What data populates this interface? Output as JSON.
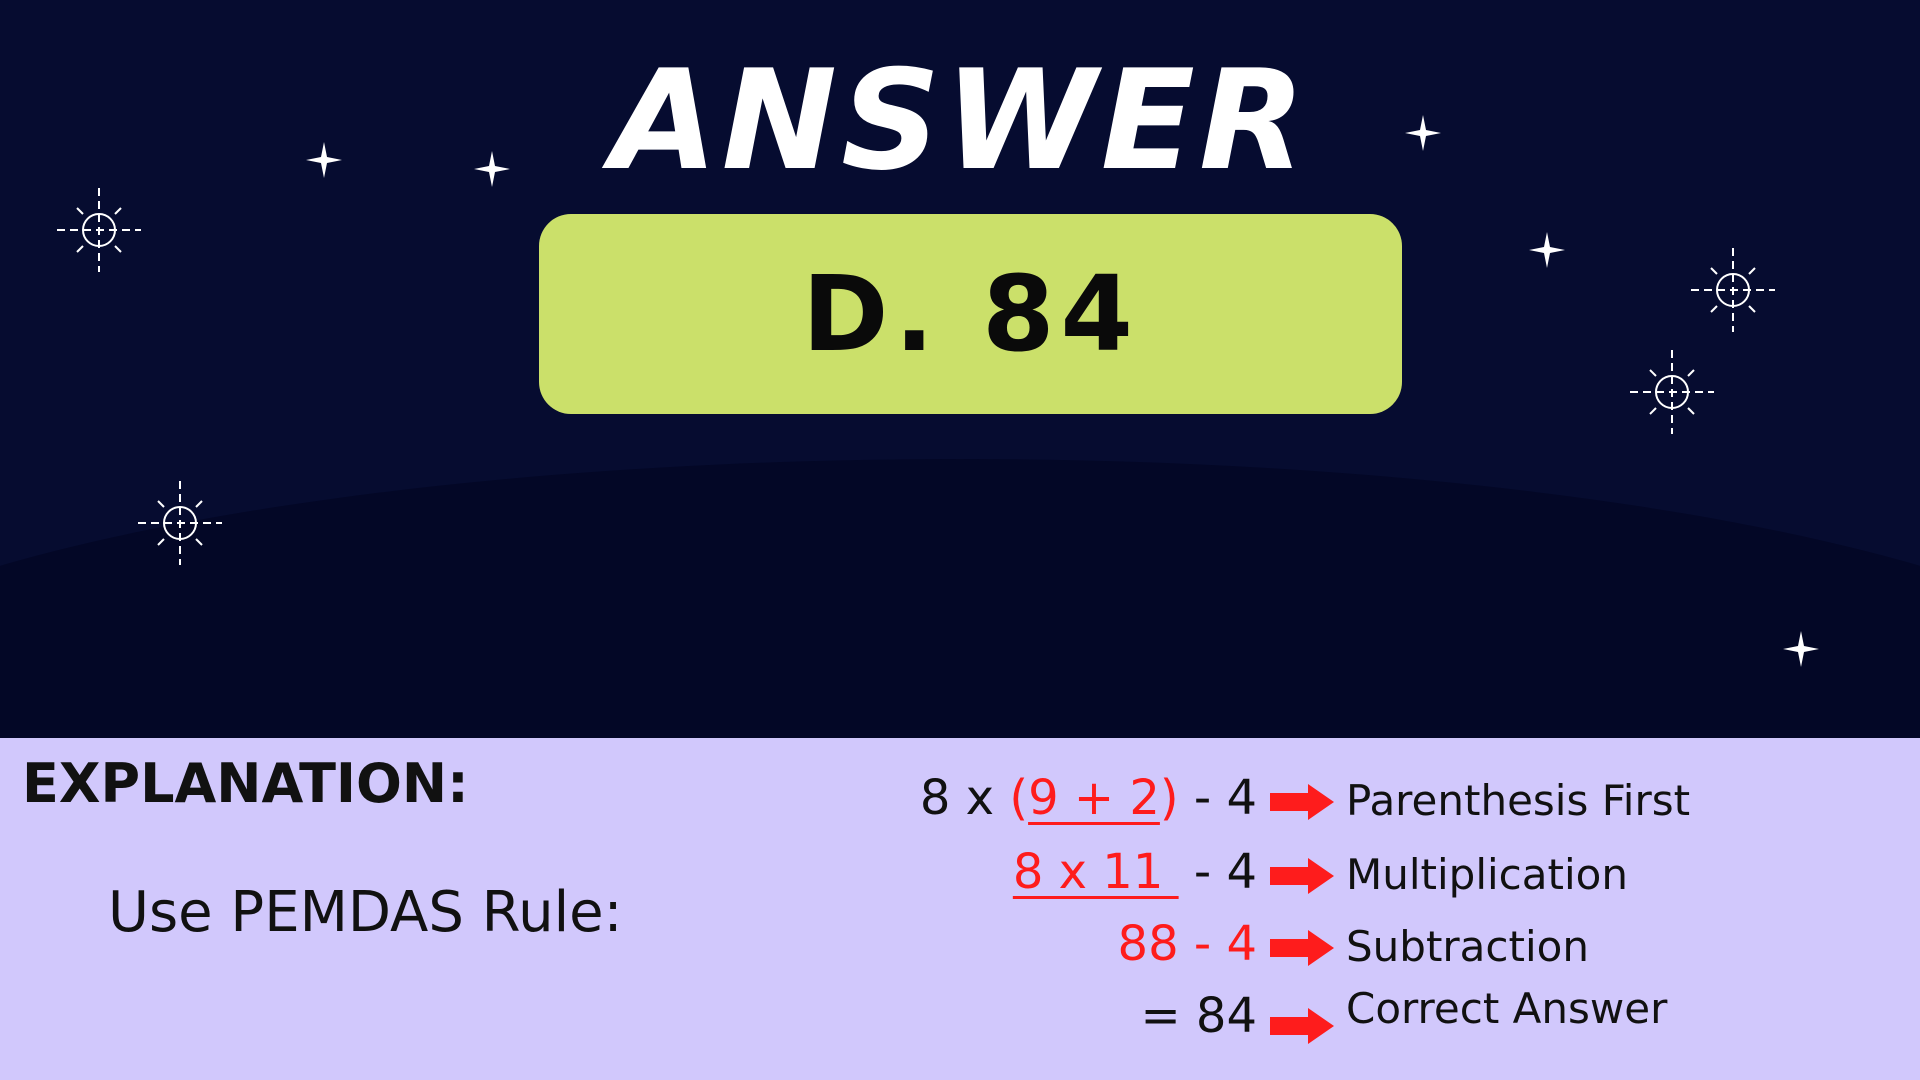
{
  "header": {
    "title": "ANSWER"
  },
  "answer": {
    "text": "D. 84",
    "box_color": "#cbe06a"
  },
  "explanation": {
    "heading": "EXPLANATION:",
    "rule": "Use PEMDAS Rule:",
    "steps": [
      {
        "parts": [
          "8 x ",
          "(",
          "9 + 2",
          ")",
          " - 4"
        ],
        "label": "Parenthesis First"
      },
      {
        "parts": [
          "8 x 11 ",
          " - 4"
        ],
        "label": "Multiplication"
      },
      {
        "parts": [
          "88 - 4"
        ],
        "label": "Subtraction"
      },
      {
        "parts": [
          "= 84"
        ],
        "label": "Correct Answer"
      }
    ]
  },
  "colors": {
    "sky": "#060c30",
    "hill": "#030726",
    "panel": "#d1c8fc",
    "highlight": "#fe1c1c",
    "arrow": "#fe1c1c"
  },
  "icons": [
    "sparkle-star-icon",
    "crosshair-star-icon",
    "right-arrow-icon"
  ]
}
